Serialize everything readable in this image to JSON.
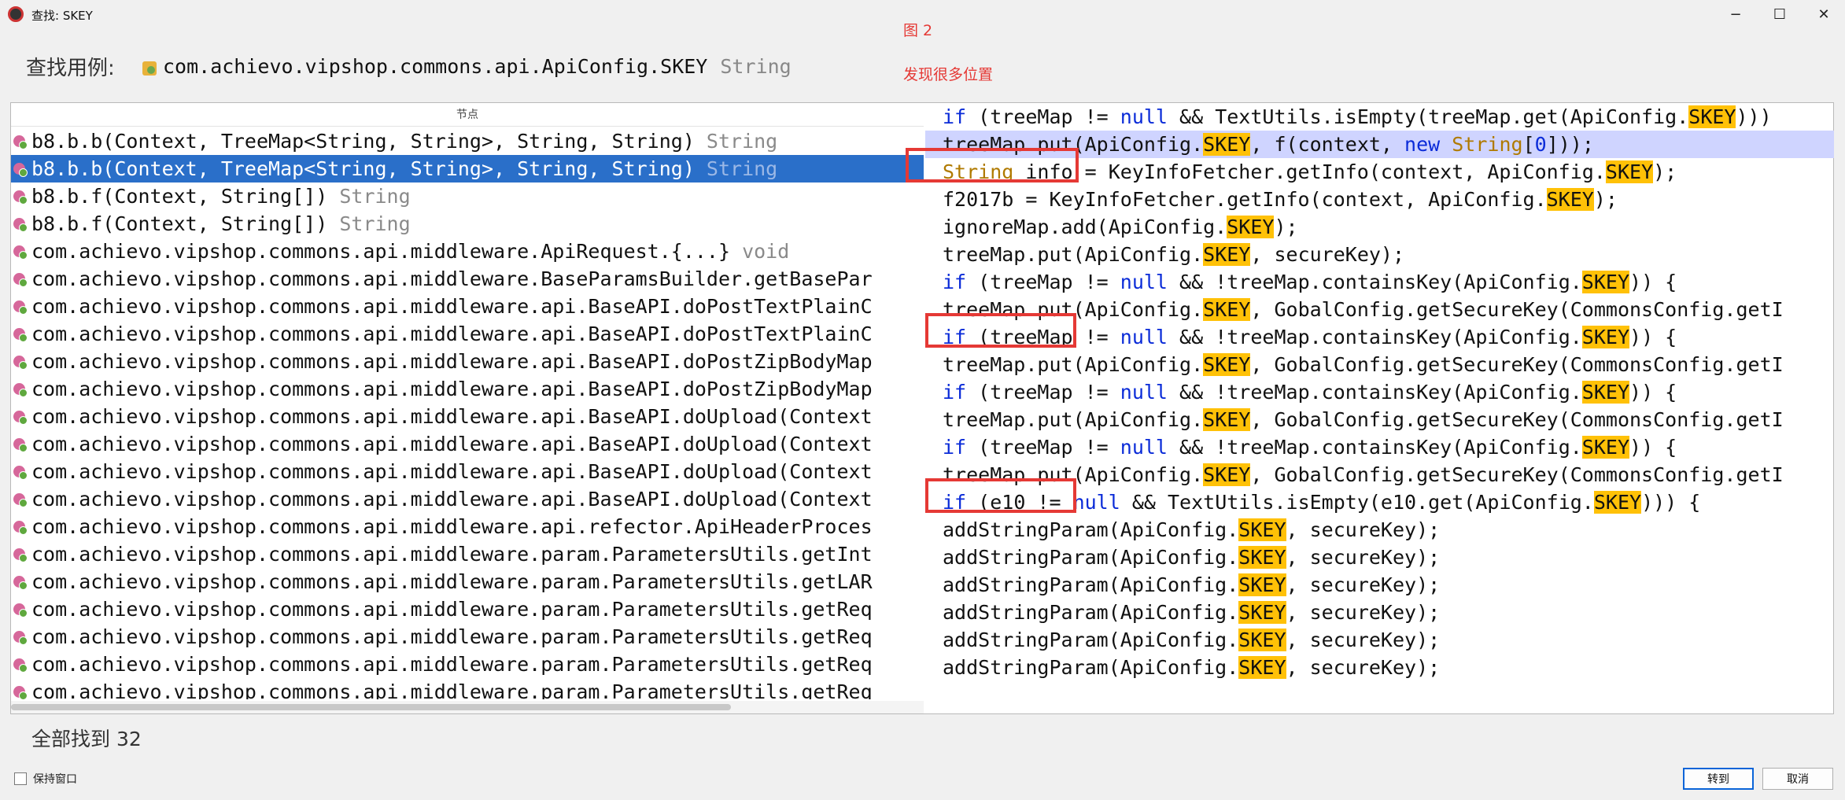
{
  "window": {
    "title": "查找: SKEY",
    "controls": {
      "minimize": "−",
      "maximize": "☐",
      "close": "✕"
    }
  },
  "annotations": {
    "figure": "图 2",
    "note": "发现很多位置"
  },
  "search": {
    "label": "查找用例:",
    "target": "com.achievo.vipshop.commons.api.ApiConfig.SKEY",
    "type": "String"
  },
  "results_panel": {
    "column_header": "节点",
    "rows": [
      {
        "text": "b8.b.b(Context, TreeMap<String, String>, String, String)",
        "type": "String",
        "selected": false
      },
      {
        "text": "b8.b.b(Context, TreeMap<String, String>, String, String)",
        "type": "String",
        "selected": true
      },
      {
        "text": "b8.b.f(Context, String[])",
        "type": "String",
        "selected": false
      },
      {
        "text": "b8.b.f(Context, String[])",
        "type": "String",
        "selected": false
      },
      {
        "text": "com.achievo.vipshop.commons.api.middleware.ApiRequest.{...}",
        "type": "void",
        "selected": false
      },
      {
        "text": "com.achievo.vipshop.commons.api.middleware.BaseParamsBuilder.getBasePar",
        "type": "",
        "selected": false
      },
      {
        "text": "com.achievo.vipshop.commons.api.middleware.api.BaseAPI.doPostTextPlainC",
        "type": "",
        "selected": false
      },
      {
        "text": "com.achievo.vipshop.commons.api.middleware.api.BaseAPI.doPostTextPlainC",
        "type": "",
        "selected": false
      },
      {
        "text": "com.achievo.vipshop.commons.api.middleware.api.BaseAPI.doPostZipBodyMap",
        "type": "",
        "selected": false
      },
      {
        "text": "com.achievo.vipshop.commons.api.middleware.api.BaseAPI.doPostZipBodyMap",
        "type": "",
        "selected": false
      },
      {
        "text": "com.achievo.vipshop.commons.api.middleware.api.BaseAPI.doUpload(Context",
        "type": "",
        "selected": false
      },
      {
        "text": "com.achievo.vipshop.commons.api.middleware.api.BaseAPI.doUpload(Context",
        "type": "",
        "selected": false
      },
      {
        "text": "com.achievo.vipshop.commons.api.middleware.api.BaseAPI.doUpload(Context",
        "type": "",
        "selected": false
      },
      {
        "text": "com.achievo.vipshop.commons.api.middleware.api.BaseAPI.doUpload(Context",
        "type": "",
        "selected": false
      },
      {
        "text": "com.achievo.vipshop.commons.api.middleware.api.refector.ApiHeaderProces",
        "type": "",
        "selected": false
      },
      {
        "text": "com.achievo.vipshop.commons.api.middleware.param.ParametersUtils.getInt",
        "type": "",
        "selected": false
      },
      {
        "text": "com.achievo.vipshop.commons.api.middleware.param.ParametersUtils.getLAR",
        "type": "",
        "selected": false
      },
      {
        "text": "com.achievo.vipshop.commons.api.middleware.param.ParametersUtils.getReq",
        "type": "",
        "selected": false
      },
      {
        "text": "com.achievo.vipshop.commons.api.middleware.param.ParametersUtils.getReq",
        "type": "",
        "selected": false
      },
      {
        "text": "com.achievo.vipshop.commons.api.middleware.param.ParametersUtils.getReq",
        "type": "",
        "selected": false
      },
      {
        "text": "com.achievo.vipshop.commons.api.middleware.param.ParametersUtils.getReq",
        "type": "",
        "selected": false
      }
    ],
    "code_lines": [
      "if (treeMap != null && TextUtils.isEmpty(treeMap.get(ApiConfig.SKEY)))",
      "treeMap.put(ApiConfig.SKEY, f(context, new String[0]));",
      "String info = KeyInfoFetcher.getInfo(context, ApiConfig.SKEY);",
      "f2017b = KeyInfoFetcher.getInfo(context, ApiConfig.SKEY);",
      "ignoreMap.add(ApiConfig.SKEY);",
      "treeMap.put(ApiConfig.SKEY, secureKey);",
      "if (treeMap != null && !treeMap.containsKey(ApiConfig.SKEY)) {",
      "treeMap.put(ApiConfig.SKEY, GobalConfig.getSecureKey(CommonsConfig.getI",
      "if (treeMap != null && !treeMap.containsKey(ApiConfig.SKEY)) {",
      "treeMap.put(ApiConfig.SKEY, GobalConfig.getSecureKey(CommonsConfig.getI",
      "if (treeMap != null && !treeMap.containsKey(ApiConfig.SKEY)) {",
      "treeMap.put(ApiConfig.SKEY, GobalConfig.getSecureKey(CommonsConfig.getI",
      "if (treeMap != null && !treeMap.containsKey(ApiConfig.SKEY)) {",
      "treeMap.put(ApiConfig.SKEY, GobalConfig.getSecureKey(CommonsConfig.getI",
      "if (e10 != null && TextUtils.isEmpty(e10.get(ApiConfig.SKEY))) {",
      "addStringParam(ApiConfig.SKEY, secureKey);",
      "addStringParam(ApiConfig.SKEY, secureKey);",
      "addStringParam(ApiConfig.SKEY, secureKey);",
      "addStringParam(ApiConfig.SKEY, secureKey);",
      "addStringParam(ApiConfig.SKEY, secureKey);",
      "addStringParam(ApiConfig.SKEY, secureKey);"
    ],
    "highlighted_code_line": 1,
    "keywords": [
      "if",
      "null",
      "new"
    ],
    "type_words": [
      "String"
    ],
    "highlight_term": "SKEY"
  },
  "status": {
    "found_text": "全部找到 32"
  },
  "footer": {
    "keep_window_label": "保持窗口",
    "goto_button": "转到",
    "cancel_button": "取消"
  },
  "colors": {
    "selection": "#2a6fc9",
    "code_highlight": "#cfd4ff",
    "skey_highlight": "#ffc107",
    "annotation_red": "#e53935"
  }
}
